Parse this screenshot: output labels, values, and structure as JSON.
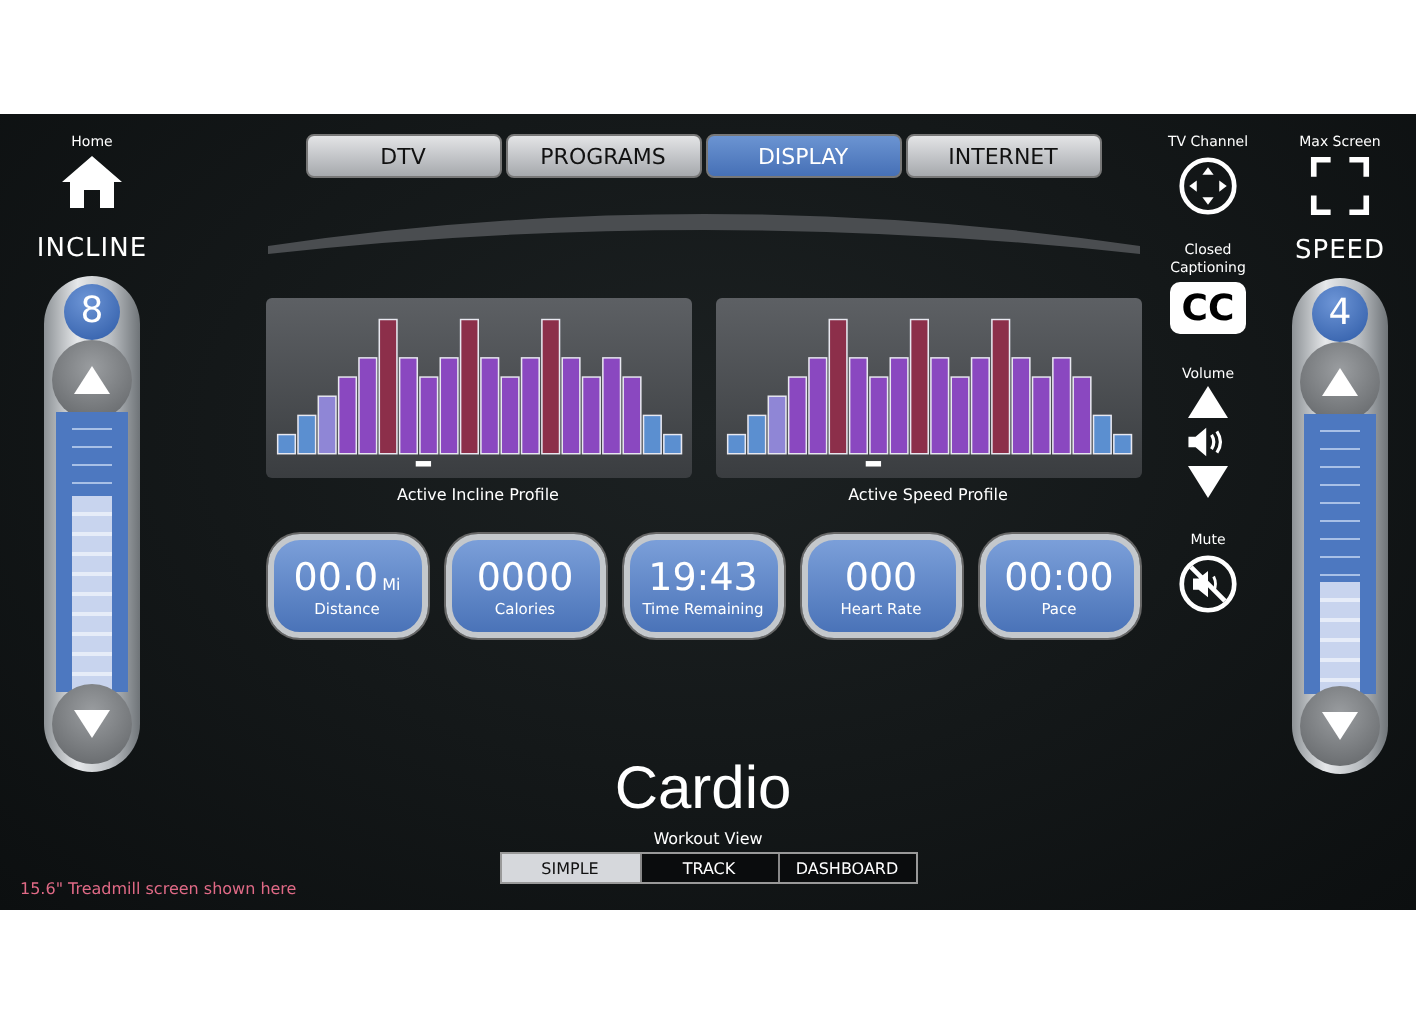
{
  "home": {
    "label": "Home"
  },
  "incline": {
    "title": "INCLINE",
    "value": "8",
    "level": 0.7
  },
  "tabs": [
    {
      "label": "DTV",
      "selected": false
    },
    {
      "label": "PROGRAMS",
      "selected": false
    },
    {
      "label": "DISPLAY",
      "selected": true
    },
    {
      "label": "INTERNET",
      "selected": false
    }
  ],
  "profiles": [
    {
      "caption": "Active Incline Profile"
    },
    {
      "caption": "Active Speed Profile"
    }
  ],
  "metrics": [
    {
      "value": "00.0",
      "unit": "Mi",
      "label": "Distance"
    },
    {
      "value": "0000",
      "label": "Calories"
    },
    {
      "value": "19:43",
      "label": "Time Remaining"
    },
    {
      "value": "000",
      "label": "Heart Rate"
    },
    {
      "value": "00:00",
      "label": "Pace"
    }
  ],
  "workout_name": "Cardio",
  "workout_view": {
    "label": "Workout View",
    "options": [
      {
        "label": "SIMPLE",
        "selected": true
      },
      {
        "label": "TRACK",
        "selected": false
      },
      {
        "label": "DASHBOARD",
        "selected": false
      }
    ]
  },
  "note": "15.6\" Treadmill screen shown here",
  "side_controls": {
    "tv_channel": "TV Channel",
    "closed_captioning": {
      "label": "Closed Captioning",
      "button": "CC"
    },
    "volume": "Volume",
    "mute": "Mute"
  },
  "max_screen": "Max Screen",
  "speed": {
    "title": "SPEED",
    "value": "4",
    "level": 0.4
  }
}
